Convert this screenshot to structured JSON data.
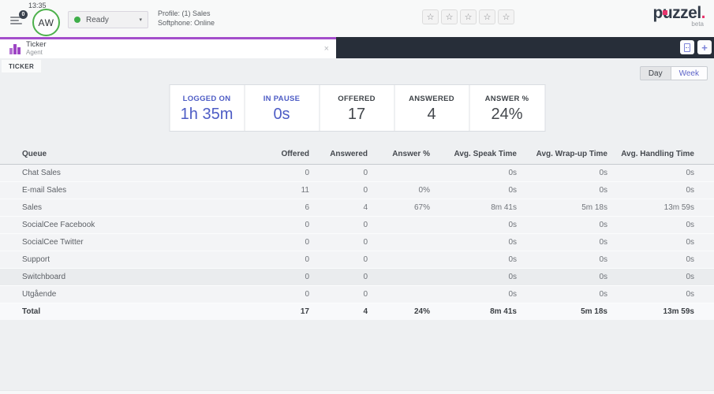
{
  "header": {
    "clock": "13:35",
    "menu_badge": "0",
    "avatar_initials": "AW",
    "status_label": "Ready",
    "profile_line1": "Profile: (1) Sales",
    "profile_line2": "Softphone: Online",
    "logo_text": "p",
    "logo_text2": "uzzel",
    "logo_dot": ".",
    "logo_beta": "beta"
  },
  "icons": {
    "star": "☆",
    "close": "×",
    "plus": "+",
    "caret": "▾"
  },
  "tabbar": {
    "tab_title": "Ticker",
    "tab_subtitle": "Agent",
    "subtab_label": "TICKER"
  },
  "toolbar": {
    "day_label": "Day",
    "week_label": "Week"
  },
  "stats": [
    {
      "label": "LOGGED ON",
      "value": "1h 35m"
    },
    {
      "label": "IN PAUSE",
      "value": "0s"
    },
    {
      "label": "OFFERED",
      "value": "17"
    },
    {
      "label": "ANSWERED",
      "value": "4"
    },
    {
      "label": "ANSWER %",
      "value": "24%"
    }
  ],
  "table": {
    "columns": [
      "Queue",
      "Offered",
      "Answered",
      "Answer %",
      "Avg. Speak Time",
      "Avg. Wrap-up Time",
      "Avg. Handling Time"
    ],
    "rows": [
      [
        "Chat Sales",
        "0",
        "0",
        "",
        "0s",
        "0s",
        "0s"
      ],
      [
        "E-mail Sales",
        "11",
        "0",
        "0%",
        "0s",
        "0s",
        "0s"
      ],
      [
        "Sales",
        "6",
        "4",
        "67%",
        "8m 41s",
        "5m 18s",
        "13m 59s"
      ],
      [
        "SocialCee Facebook",
        "0",
        "0",
        "",
        "0s",
        "0s",
        "0s"
      ],
      [
        "SocialCee Twitter",
        "0",
        "0",
        "",
        "0s",
        "0s",
        "0s"
      ],
      [
        "Support",
        "0",
        "0",
        "",
        "0s",
        "0s",
        "0s"
      ],
      [
        "Switchboard",
        "0",
        "0",
        "",
        "0s",
        "0s",
        "0s"
      ],
      [
        "Utgående",
        "0",
        "0",
        "",
        "0s",
        "0s",
        "0s"
      ]
    ],
    "total": [
      "Total",
      "17",
      "4",
      "24%",
      "8m 41s",
      "5m 18s",
      "13m 59s"
    ]
  },
  "colors": {
    "accent_purple": "#a44ecb",
    "accent_blue": "#4d5cc5",
    "status_green": "#3fae49",
    "brand_pink": "#e8356d",
    "darkbar": "#272e39",
    "content_bg": "#eef0f2"
  }
}
